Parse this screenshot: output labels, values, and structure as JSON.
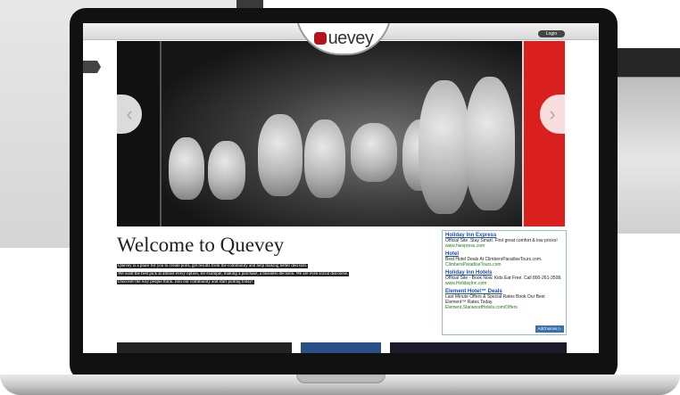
{
  "site": {
    "brand": "uevey",
    "login_label": "Login"
  },
  "hero": {
    "prev_symbol": "‹",
    "next_symbol": "›"
  },
  "welcome": {
    "title": "Welcome to Quevey",
    "lines": [
      "Quevey is a place for you to create polls, get results from the community and help making better decision.",
      "We want the best pick at almost every option, for example, making a purchase, a business decision. We are even social discourse.",
      "Discover the way people think. Join our community and start polling today!"
    ]
  },
  "ads": [
    {
      "title": "Holiday Inn Express",
      "desc": "Official Site. Stay Smart. First great comfort & low prices!",
      "url": "www.hiexpress.com"
    },
    {
      "title": "Hotel",
      "desc": "Best Hotel Deals At ClimbersParadiseTours.com.",
      "url": "ClimbersParadiseTours.com"
    },
    {
      "title": "Holiday Inn Hotels",
      "desc": "Official Site - Book Now. Kids Eat Free. Call 800-261-3508.",
      "url": "www.HolidayInn.com"
    },
    {
      "title": "Element Hotel™ Deals",
      "desc": "Last Minute Offers & Special Rates Book Our Best Element™ Rates Today.",
      "url": "Element.StarwoodHotels.com/Offers"
    }
  ],
  "adchoices_label": "AdChoices ▷",
  "colors": {
    "brand_red": "#b5121b",
    "ad_link": "#1a4fb0",
    "ad_url": "#1a7a1a"
  }
}
